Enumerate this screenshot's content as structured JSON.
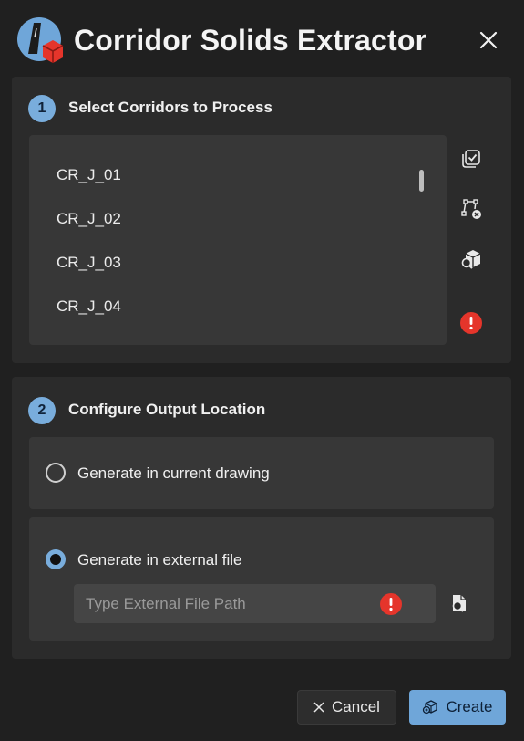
{
  "window": {
    "title": "Corridor Solids Extractor",
    "close_label": "Close",
    "logo_icon": "corridor-road-cube-icon"
  },
  "step1": {
    "number": "1",
    "title": "Select Corridors to Process",
    "corridors": [
      "CR_J_01",
      "CR_J_02",
      "CR_J_03",
      "CR_J_04"
    ],
    "tools": [
      "select-all-icon",
      "select-in-drawing-icon",
      "inspect-solids-icon",
      "error-icon"
    ]
  },
  "step2": {
    "number": "2",
    "title": "Configure Output Location",
    "option_current": "Generate in current drawing",
    "option_current_selected": false,
    "option_external": "Generate in external file",
    "option_external_selected": true,
    "path_placeholder": "Type External File Path",
    "path_value": ""
  },
  "actions": {
    "cancel_label": "Cancel",
    "create_label": "Create"
  },
  "colors": {
    "accent": "#79addc",
    "error": "#e5352b",
    "background": "#202020",
    "panel": "#2b2b2b"
  }
}
